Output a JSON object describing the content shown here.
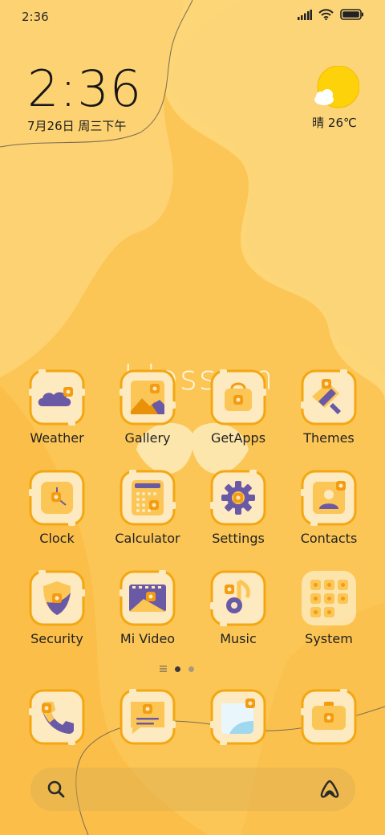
{
  "status_bar": {
    "time": "2:36",
    "icons": [
      "signal-icon",
      "wifi-icon",
      "battery-icon"
    ]
  },
  "clock_widget": {
    "time": "2:36",
    "date": "7月26日 周三下午"
  },
  "weather_widget": {
    "icon": "sun-cloud-icon",
    "text": "晴 26℃"
  },
  "wallpaper_text": "blossom",
  "apps": [
    {
      "label": "Weather",
      "icon": "weather-icon"
    },
    {
      "label": "Gallery",
      "icon": "gallery-icon"
    },
    {
      "label": "GetApps",
      "icon": "getapps-icon"
    },
    {
      "label": "Themes",
      "icon": "themes-icon"
    },
    {
      "label": "Clock",
      "icon": "clock-icon"
    },
    {
      "label": "Calculator",
      "icon": "calculator-icon"
    },
    {
      "label": "Settings",
      "icon": "settings-icon"
    },
    {
      "label": "Contacts",
      "icon": "contacts-icon"
    },
    {
      "label": "Security",
      "icon": "security-icon"
    },
    {
      "label": "Mi Video",
      "icon": "mi-video-icon"
    },
    {
      "label": "Music",
      "icon": "music-icon"
    },
    {
      "label": "System",
      "icon": "system-folder-icon"
    }
  ],
  "dock": [
    {
      "icon": "phone-icon"
    },
    {
      "icon": "messages-icon"
    },
    {
      "icon": "browser-icon"
    },
    {
      "icon": "camera-icon"
    }
  ],
  "page_indicator": {
    "pages": 2,
    "current": 1
  },
  "search_bar": {
    "left_icon": "search-icon",
    "right_icon": "assistant-icon"
  },
  "colors": {
    "wallpaper_light": "#fdd06a",
    "wallpaper_dark": "#fcc24f",
    "icon_bg": "#fdeac0",
    "icon_border": "#f3a712",
    "accent_purple": "#6a5aa6",
    "accent_orange": "#f39c12"
  }
}
